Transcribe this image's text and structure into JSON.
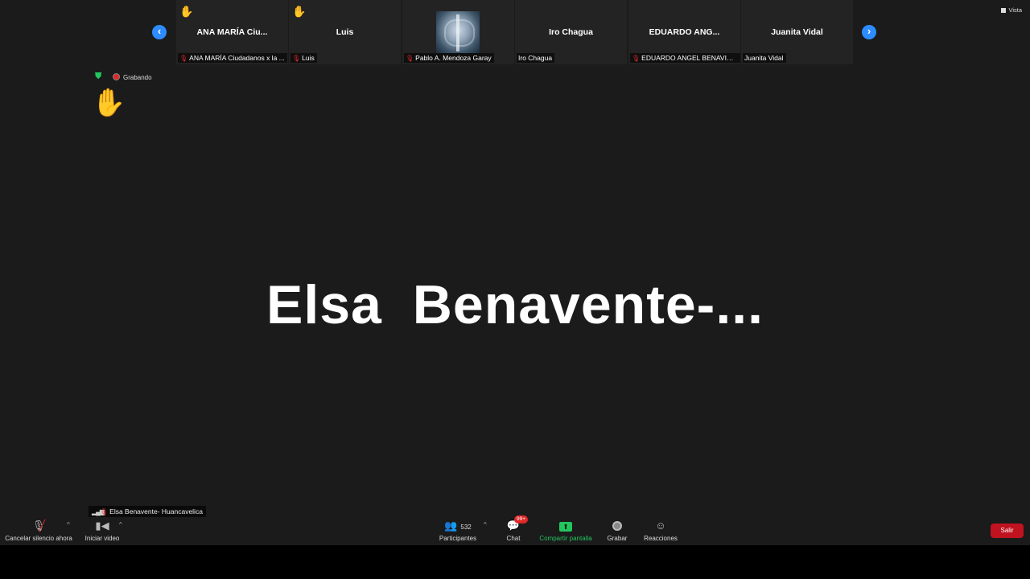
{
  "top_strip": {
    "tiles": [
      {
        "name": "ANA MARÍA Ciu...",
        "label": "ANA MARÍA Ciudadanos x la ...",
        "hand": "✋",
        "muted": true,
        "video": false
      },
      {
        "name": "Luis",
        "label": "Luis",
        "hand": "✋",
        "muted": true,
        "video": false
      },
      {
        "name": "",
        "label": "Pablo A. Mendoza Garay",
        "hand": "",
        "muted": true,
        "video": true
      },
      {
        "name": "Iro Chagua",
        "label": "Iro Chagua",
        "hand": "",
        "muted": false,
        "video": false
      },
      {
        "name": "EDUARDO ANG...",
        "label": "EDUARDO ANGEL BENAVIDES...",
        "hand": "",
        "muted": true,
        "video": false
      },
      {
        "name": "Juanita Vidal",
        "label": "Juanita Vidal",
        "hand": "",
        "muted": false,
        "video": false
      }
    ],
    "prev_icon": "‹",
    "next_icon": "›",
    "view_label": "Vista"
  },
  "status": {
    "security_icon": "shield-check-icon",
    "recording_label": "Grabando",
    "raised_hand": "✋"
  },
  "main": {
    "speaker_name": "Elsa  Benavente-..."
  },
  "active_name_tag": "Elsa Benavente- Huancavelica",
  "toolbar": {
    "unmute_label": "Cancelar silencio ahora",
    "video_label": "Iniciar video",
    "participants_label": "Participantes",
    "participants_count": "532",
    "chat_label": "Chat",
    "chat_badge": "99+",
    "share_label": "Compartir pantalla",
    "record_label": "Grabar",
    "reactions_label": "Reacciones",
    "leave_label": "Salir"
  },
  "colors": {
    "background": "#1b1b1b",
    "accent_blue": "#2d8cff",
    "share_green": "#22c55e",
    "leave_red": "#c1121f"
  }
}
